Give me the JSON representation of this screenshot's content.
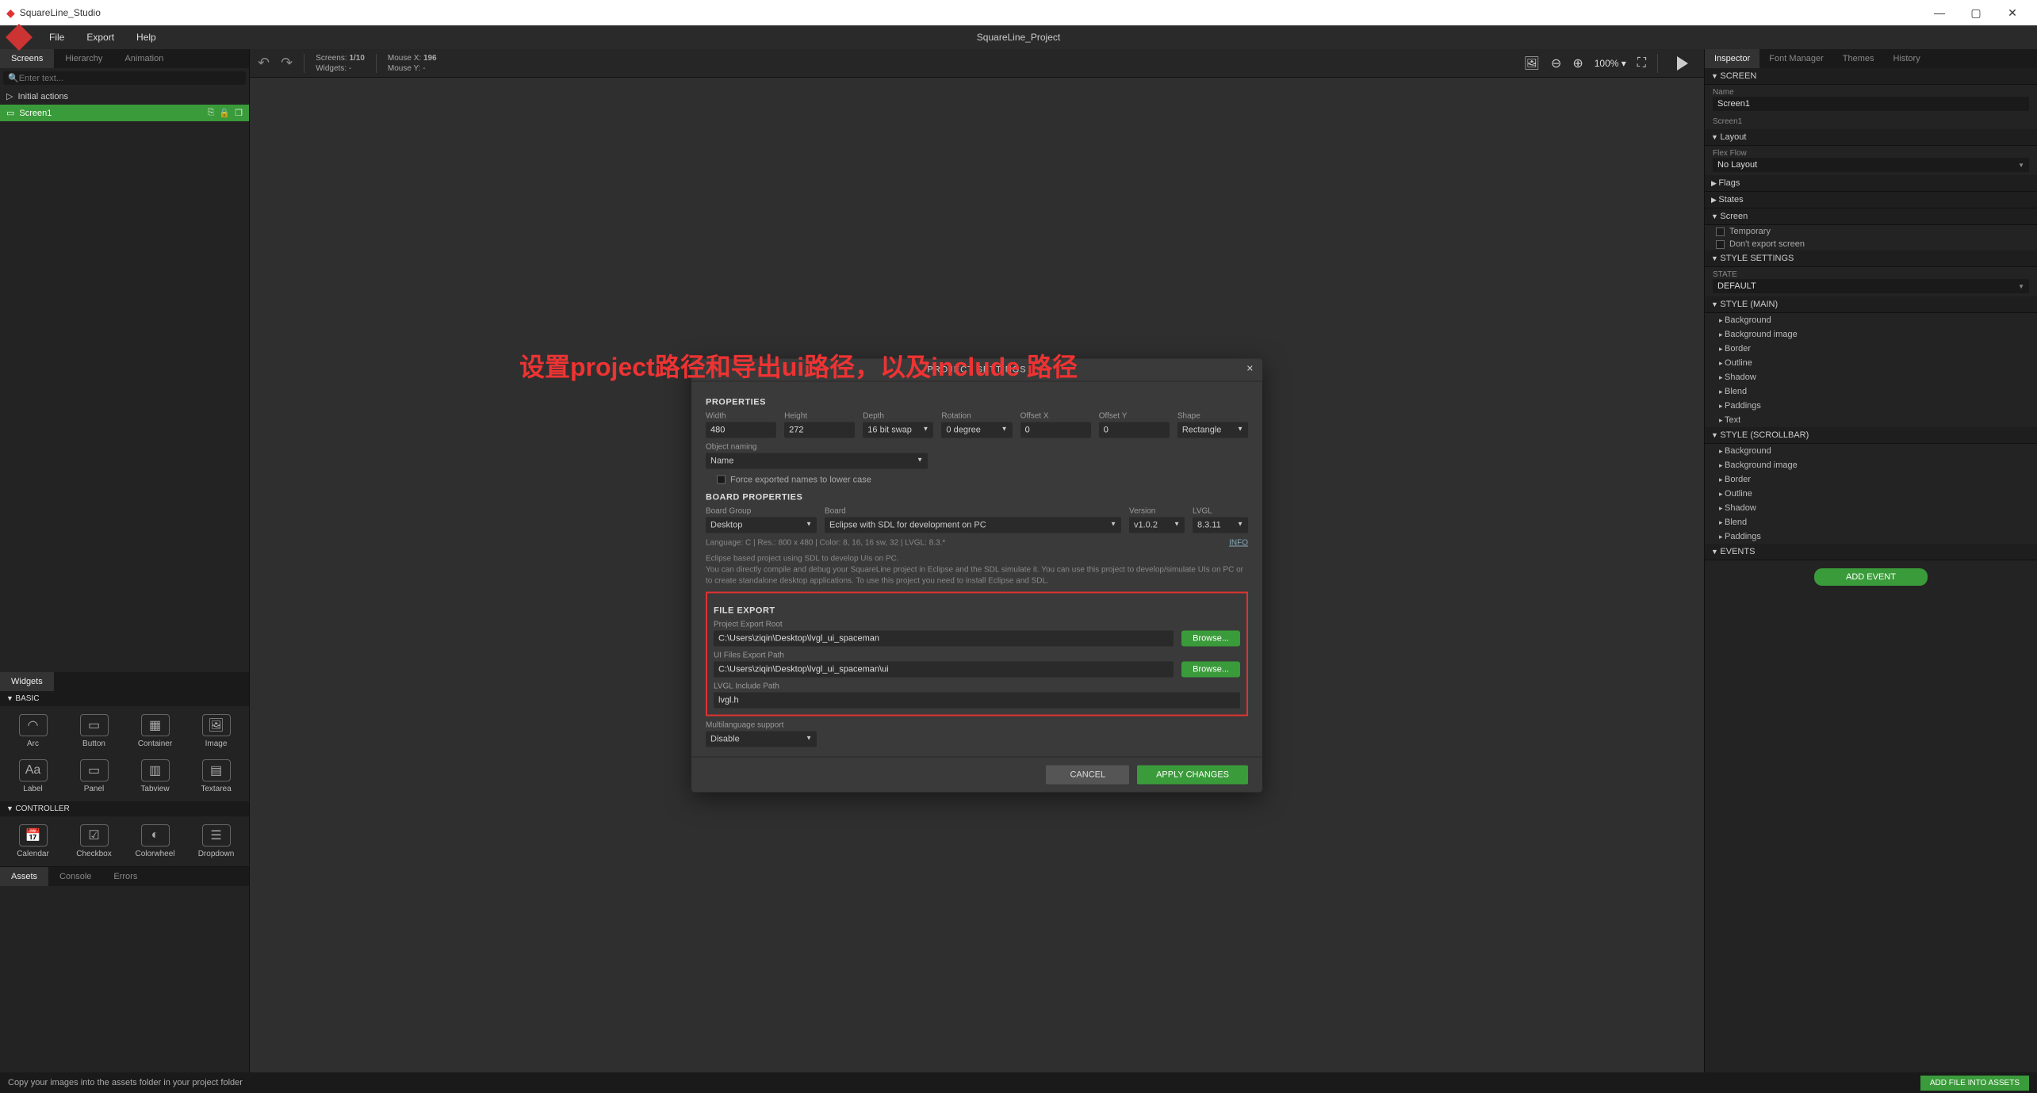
{
  "app": {
    "title": "SquareLine_Studio",
    "project": "SquareLine_Project"
  },
  "menu": {
    "file": "File",
    "export": "Export",
    "help": "Help"
  },
  "winbtns": {
    "min": "—",
    "max": "▢",
    "close": "✕"
  },
  "leftTabs": {
    "screens": "Screens",
    "hierarchy": "Hierarchy",
    "animation": "Animation"
  },
  "search": {
    "placeholder": "Enter text..."
  },
  "tree": {
    "initial": "Initial actions",
    "screen1": "Screen1"
  },
  "toolbar": {
    "screens_l": "Screens:",
    "screens_v": "1/10",
    "widgets_l": "Widgets:",
    "widgets_v": "-",
    "mousex_l": "Mouse X:",
    "mousex_v": "196",
    "mousey_l": "Mouse Y:",
    "mousey_v": "-",
    "zoom": "100% ▾"
  },
  "widgetsTab": "Widgets",
  "wBasic": "BASIC",
  "wController": "CONTROLLER",
  "widgets_basic": [
    "Arc",
    "Button",
    "Container",
    "Image",
    "Label",
    "Panel",
    "Tabview",
    "Textarea"
  ],
  "widgets_ctrl": [
    "Calendar",
    "Checkbox",
    "Colorwheel",
    "Dropdown"
  ],
  "rightTabs": {
    "inspector": "Inspector",
    "font": "Font Manager",
    "themes": "Themes",
    "history": "History"
  },
  "insp": {
    "screen": "SCREEN",
    "name_l": "Name",
    "name_v": "Screen1",
    "name_sub": "Screen1",
    "layout": "Layout",
    "flex_l": "Flex Flow",
    "flex_v": "No Layout",
    "flags": "Flags",
    "states": "States",
    "screen2": "Screen",
    "temp": "Temporary",
    "noexport": "Don't export screen",
    "stylesettings": "STYLE SETTINGS",
    "state_l": "STATE",
    "state_v": "DEFAULT",
    "stylemain": "STYLE (MAIN)",
    "styles": [
      "Background",
      "Background image",
      "Border",
      "Outline",
      "Shadow",
      "Blend",
      "Paddings",
      "Text"
    ],
    "stylescroll": "STYLE (SCROLLBAR)",
    "styles2": [
      "Background",
      "Background image",
      "Border",
      "Outline",
      "Shadow",
      "Blend",
      "Paddings"
    ],
    "events": "EVENTS",
    "addevent": "ADD EVENT"
  },
  "bottomTabs": {
    "assets": "Assets",
    "console": "Console",
    "errors": "Errors"
  },
  "status": {
    "msg": "Copy your images into the assets folder in your project folder",
    "addasset": "ADD FILE INTO ASSETS"
  },
  "modal": {
    "title": "PROJECT SETTINGS",
    "properties": "PROPERTIES",
    "width_l": "Width",
    "width_v": "480",
    "height_l": "Height",
    "height_v": "272",
    "depth_l": "Depth",
    "depth_v": "16 bit swap",
    "rot_l": "Rotation",
    "rot_v": "0 degree",
    "offx_l": "Offset X",
    "offx_v": "0",
    "offy_l": "Offset Y",
    "offy_v": "0",
    "shape_l": "Shape",
    "shape_v": "Rectangle",
    "objname_l": "Object naming",
    "objname_v": "Name",
    "force": "Force exported names to lower case",
    "boardprops": "BOARD PROPERTIES",
    "bgroup_l": "Board Group",
    "bgroup_v": "Desktop",
    "board_l": "Board",
    "board_v": "Eclipse with SDL for development on PC",
    "ver_l": "Version",
    "ver_v": "v1.0.2",
    "lvgl_l": "LVGL",
    "lvgl_v": "8.3.11",
    "langline": "Language: C  |  Res.: 800 x 480  |  Color: 8, 16, 16 sw, 32  |  LVGL: 8.3.*",
    "info": "INFO",
    "desc": "Eclipse based project using SDL to develop UIs on PC.\nYou can directly compile and debug your SquareLine project in Eclipse and the SDL simulate it. You can use this project to develop/simulate UIs on PC or to create standalone desktop applications. To use this project you need to install Eclipse and SDL.",
    "fileexport": "FILE EXPORT",
    "proot_l": "Project Export Root",
    "proot_v": "C:\\Users\\ziqin\\Desktop\\lvgl_ui_spaceman",
    "uipath_l": "UI Files Export Path",
    "uipath_v": "C:\\Users\\ziqin\\Desktop\\lvgl_ui_spaceman\\ui",
    "inc_l": "LVGL Include Path",
    "inc_v": "lvgl.h",
    "browse": "Browse...",
    "multi_l": "Multilanguage support",
    "multi_v": "Disable",
    "cancel": "CANCEL",
    "apply": "APPLY CHANGES"
  },
  "overlay": "设置project路径和导出ui路径，以及include 路径"
}
